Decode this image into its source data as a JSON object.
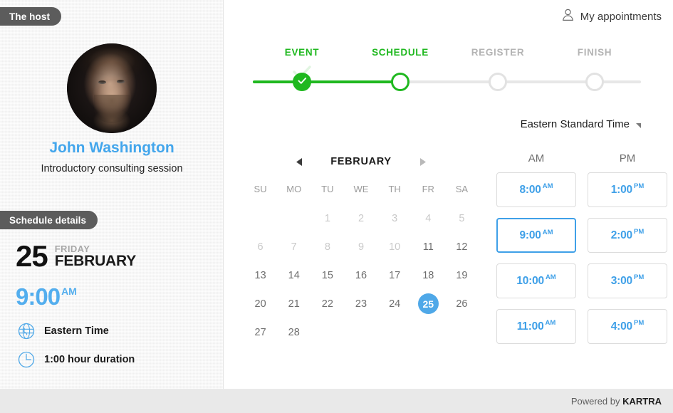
{
  "header": {
    "my_appointments_label": "My appointments",
    "user_icon": "user-icon"
  },
  "sidebar": {
    "host_tag": "The host",
    "schedule_tag": "Schedule details",
    "host_name": "John Washington",
    "host_subtitle": "Introductory consulting session",
    "avatar_icon": "avatar",
    "details": {
      "day_number": "25",
      "weekday": "FRIDAY",
      "month": "FEBRUARY",
      "time_hour": "9:00",
      "time_meridiem": "AM",
      "timezone_icon": "globe-icon",
      "timezone_label": "Eastern Time",
      "duration_icon": "clock-icon",
      "duration_label": "1:00 hour duration"
    }
  },
  "stepper": {
    "steps": [
      {
        "label": "EVENT",
        "state": "done"
      },
      {
        "label": "SCHEDULE",
        "state": "active"
      },
      {
        "label": "REGISTER",
        "state": "inactive"
      },
      {
        "label": "FINISH",
        "state": "inactive"
      }
    ],
    "active_color": "#1fb81f",
    "inactive_color": "#b4b4b4"
  },
  "timezone": {
    "selected": "Eastern Standard Time",
    "caret_icon": "chevron-down-icon"
  },
  "calendar": {
    "month_title": "FEBRUARY",
    "prev_icon": "triangle-left-icon",
    "next_icon": "triangle-right-icon",
    "day_headers": [
      "SU",
      "MO",
      "TU",
      "WE",
      "TH",
      "FR",
      "SA"
    ],
    "leading_blanks": 2,
    "days": [
      {
        "n": "1",
        "state": "dim"
      },
      {
        "n": "2",
        "state": "dim"
      },
      {
        "n": "3",
        "state": "dim"
      },
      {
        "n": "4",
        "state": "dim"
      },
      {
        "n": "5",
        "state": "dim"
      },
      {
        "n": "6",
        "state": "dim"
      },
      {
        "n": "7",
        "state": "dim"
      },
      {
        "n": "8",
        "state": "dim"
      },
      {
        "n": "9",
        "state": "dim"
      },
      {
        "n": "10",
        "state": "dim"
      },
      {
        "n": "11",
        "state": "normal"
      },
      {
        "n": "12",
        "state": "normal"
      },
      {
        "n": "13",
        "state": "normal"
      },
      {
        "n": "14",
        "state": "normal"
      },
      {
        "n": "15",
        "state": "normal"
      },
      {
        "n": "16",
        "state": "normal"
      },
      {
        "n": "17",
        "state": "normal"
      },
      {
        "n": "18",
        "state": "normal"
      },
      {
        "n": "19",
        "state": "normal"
      },
      {
        "n": "20",
        "state": "normal"
      },
      {
        "n": "21",
        "state": "normal"
      },
      {
        "n": "22",
        "state": "normal"
      },
      {
        "n": "23",
        "state": "normal"
      },
      {
        "n": "24",
        "state": "normal"
      },
      {
        "n": "25",
        "state": "selected"
      },
      {
        "n": "26",
        "state": "normal"
      },
      {
        "n": "27",
        "state": "normal"
      },
      {
        "n": "28",
        "state": "normal"
      }
    ],
    "selected_day": "25",
    "selected_color": "#4fa8e8"
  },
  "slots": {
    "am_header": "AM",
    "pm_header": "PM",
    "am": [
      {
        "time": "8:00",
        "meridiem": "AM",
        "selected": false
      },
      {
        "time": "9:00",
        "meridiem": "AM",
        "selected": true
      },
      {
        "time": "10:00",
        "meridiem": "AM",
        "selected": false
      },
      {
        "time": "11:00",
        "meridiem": "AM",
        "selected": false
      }
    ],
    "pm": [
      {
        "time": "1:00",
        "meridiem": "PM",
        "selected": false
      },
      {
        "time": "2:00",
        "meridiem": "PM",
        "selected": false
      },
      {
        "time": "3:00",
        "meridiem": "PM",
        "selected": false
      },
      {
        "time": "4:00",
        "meridiem": "PM",
        "selected": false
      }
    ],
    "accent_color": "#3fa0e8"
  },
  "footer": {
    "powered_prefix": "Powered by ",
    "brand": "KARTRA"
  }
}
